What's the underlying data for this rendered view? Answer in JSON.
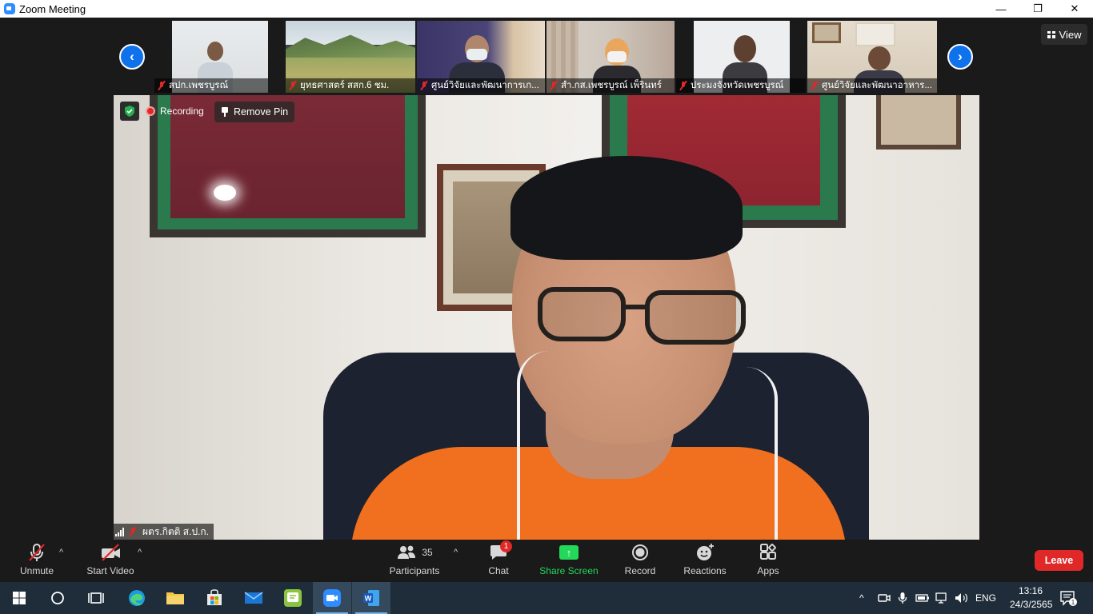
{
  "window": {
    "title": "Zoom Meeting",
    "minimize_glyph": "—",
    "restore_glyph": "❐",
    "close_glyph": "✕"
  },
  "thumbnails": [
    {
      "name": "สปก.เพชรบูรณ์",
      "muted": true
    },
    {
      "name": "ยุทธศาสตร์ สสก.6 ชม.",
      "muted": true
    },
    {
      "name": "ศูนย์วิจัยและพัฒนาการเก...",
      "muted": true
    },
    {
      "name": "สำ.กส.เพชรบูรณ์ เพ็รินทร์",
      "muted": true
    },
    {
      "name": "ประมงจังหวัดเพชรบูรณ์",
      "muted": true
    },
    {
      "name": "ศูนย์วิจัยและพัฒนาอาหาร...",
      "muted": true
    }
  ],
  "view_button": {
    "label": "View"
  },
  "main_video": {
    "recording_label": "Recording",
    "remove_pin_label": "Remove Pin",
    "speaker_name": "ผตร.กิตติ ส.ป.ก."
  },
  "toolbar": {
    "unmute_label": "Unmute",
    "start_video_label": "Start Video",
    "participants_label": "Participants",
    "participants_count": "35",
    "chat_label": "Chat",
    "chat_badge": "1",
    "share_screen_label": "Share Screen",
    "record_label": "Record",
    "reactions_label": "Reactions",
    "apps_label": "Apps",
    "leave_label": "Leave",
    "share_color": "#23d959",
    "leave_color": "#e02828"
  },
  "taskbar": {
    "language": "ENG",
    "time": "13:16",
    "date": "24/3/2565",
    "notification_count": "1"
  }
}
